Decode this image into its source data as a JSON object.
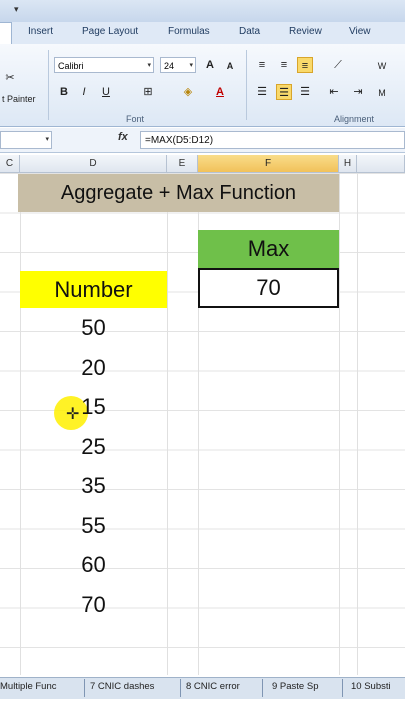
{
  "ribbon": {
    "tabs": [
      "Insert",
      "Page Layout",
      "Formulas",
      "Data",
      "Review",
      "View"
    ],
    "font_name": "Calibri",
    "font_size": "24",
    "painter_label": "t Painter",
    "group_font": "Font",
    "group_alignment": "Alignment",
    "bold": "B",
    "italic": "I",
    "underline": "U",
    "grow_font": "A",
    "shrink_font": "A",
    "font_color": "A",
    "wrap_partial": "W",
    "merge_partial": "M"
  },
  "formula_bar": {
    "fx_label": "fx",
    "formula": "=MAX(D5:D12)"
  },
  "columns": [
    "C",
    "D",
    "E",
    "F",
    "H"
  ],
  "sheet": {
    "title": "Aggregate + Max Function",
    "number_header": "Number",
    "numbers": [
      "50",
      "20",
      "15",
      "25",
      "35",
      "55",
      "60",
      "70"
    ],
    "max_header": "Max",
    "max_value": "70"
  },
  "sheet_tabs": [
    "Multiple Func",
    "7 CNIC dashes",
    "8 CNIC error",
    "9 Paste Sp",
    "10 Substi"
  ],
  "colors": {
    "title_bg": "#c8bea6",
    "number_header_bg": "#ffff00",
    "max_header_bg": "#6fc04a",
    "cursor_highlight": "#fff000"
  }
}
